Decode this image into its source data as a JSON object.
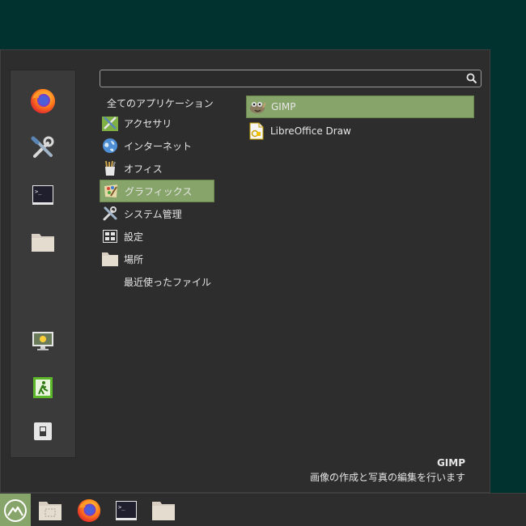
{
  "search": {
    "value": "",
    "placeholder": ""
  },
  "favorites": [
    {
      "name": "firefox-icon"
    },
    {
      "name": "system-tools-icon"
    },
    {
      "name": "terminal-icon"
    },
    {
      "name": "folder-icon"
    },
    {
      "name": "lock-screen-icon"
    },
    {
      "name": "logout-icon"
    },
    {
      "name": "shutdown-icon"
    }
  ],
  "categories": [
    {
      "label": "全てのアプリケーション"
    },
    {
      "label": "アクセサリ"
    },
    {
      "label": "インターネット"
    },
    {
      "label": "オフィス"
    },
    {
      "label": "グラフィックス"
    },
    {
      "label": "システム管理"
    },
    {
      "label": "設定"
    },
    {
      "label": "場所"
    },
    {
      "label": "最近使ったファイル"
    }
  ],
  "apps": [
    {
      "label": "GIMP"
    },
    {
      "label": "LibreOffice Draw"
    }
  ],
  "description": {
    "name": "GIMP",
    "text": "画像の作成と写真の編集を行います"
  },
  "colors": {
    "selection": "#87a46a",
    "desktop": "#013230",
    "menu_bg": "#2d2d2d"
  }
}
